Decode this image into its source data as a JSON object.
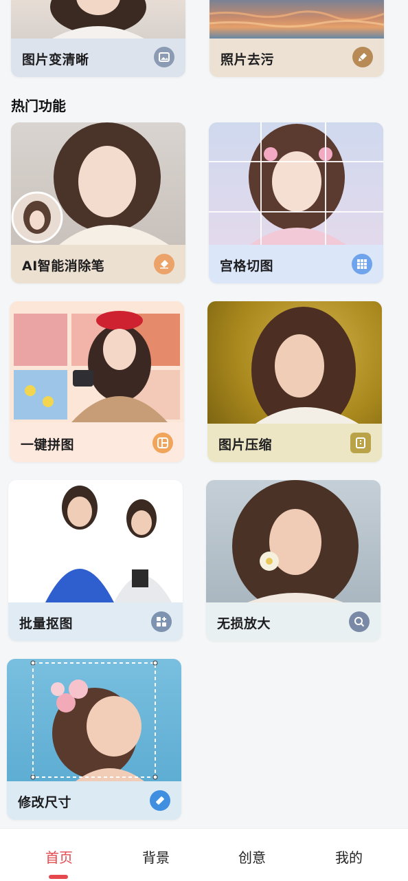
{
  "top_cards": [
    {
      "label": "图片变清晰",
      "icon": "image-icon"
    },
    {
      "label": "照片去污",
      "icon": "brush-icon"
    }
  ],
  "section": {
    "title": "热门功能"
  },
  "features": [
    {
      "label": "AI智能消除笔",
      "icon": "eraser-icon"
    },
    {
      "label": "宫格切图",
      "icon": "grid-icon"
    },
    {
      "label": "一键拼图",
      "icon": "collage-icon"
    },
    {
      "label": "图片压缩",
      "icon": "compress-icon"
    },
    {
      "label": "批量抠图",
      "icon": "batch-cutout-icon"
    },
    {
      "label": "无损放大",
      "icon": "magnify-icon"
    },
    {
      "label": "修改尺寸",
      "icon": "ruler-icon"
    }
  ],
  "tabs": [
    {
      "label": "首页",
      "active": true
    },
    {
      "label": "背景",
      "active": false
    },
    {
      "label": "创意",
      "active": false
    },
    {
      "label": "我的",
      "active": false
    }
  ],
  "colors": {
    "accent": "#e5484d",
    "page_bg": "#f5f6f8"
  }
}
